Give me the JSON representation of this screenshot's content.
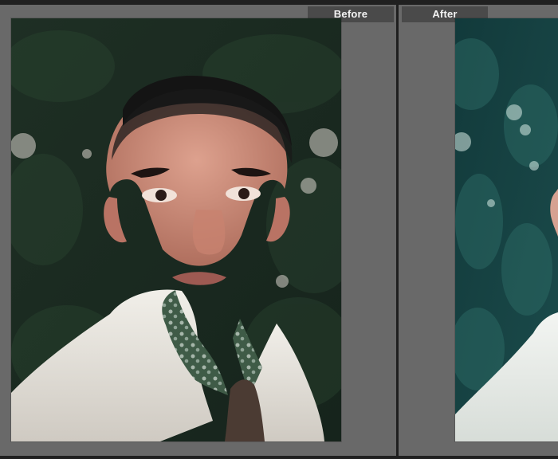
{
  "compare": {
    "before_label": "Before",
    "after_label": "After"
  },
  "colors": {
    "window_bg": "#5f5f5f",
    "pane_bg": "#696969",
    "label_bg": "#4a4a4a",
    "label_text": "#f4f4f4",
    "divider": "#1f1f1f"
  },
  "icons": {
    "before_image": "portrait-photo-icon",
    "after_image": "portrait-photo-icon"
  }
}
